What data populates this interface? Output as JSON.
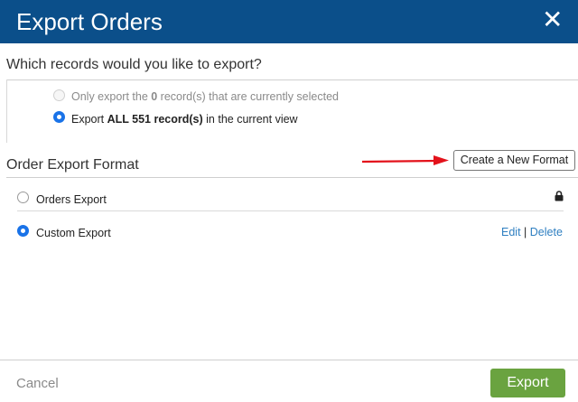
{
  "dialog": {
    "title": "Export Orders",
    "close_icon": "close-icon"
  },
  "records_section": {
    "title": "Which records would you like to export?",
    "options": [
      {
        "prefix": "Only export the ",
        "count": "0",
        "suffix": " record(s) that are currently selected",
        "selected": false,
        "disabled": true
      },
      {
        "prefix": "Export ",
        "count": "ALL 551 record(s)",
        "suffix": " in the current view",
        "selected": true,
        "disabled": false
      }
    ]
  },
  "format_section": {
    "title": "Order Export Format",
    "create_button_label": "Create a New Format",
    "formats": [
      {
        "label": "Orders Export",
        "selected": false,
        "locked": true,
        "lock_icon": "lock-icon"
      },
      {
        "label": "Custom Export",
        "selected": true,
        "edit_label": "Edit",
        "separator": "|",
        "delete_label": "Delete"
      }
    ]
  },
  "footer": {
    "cancel_label": "Cancel",
    "export_label": "Export"
  },
  "colors": {
    "header_bg": "#0b4f8a",
    "radio_selected": "#1a73e8",
    "link": "#2f7fc1",
    "export_button": "#6aa340",
    "arrow": "#e3121b"
  }
}
